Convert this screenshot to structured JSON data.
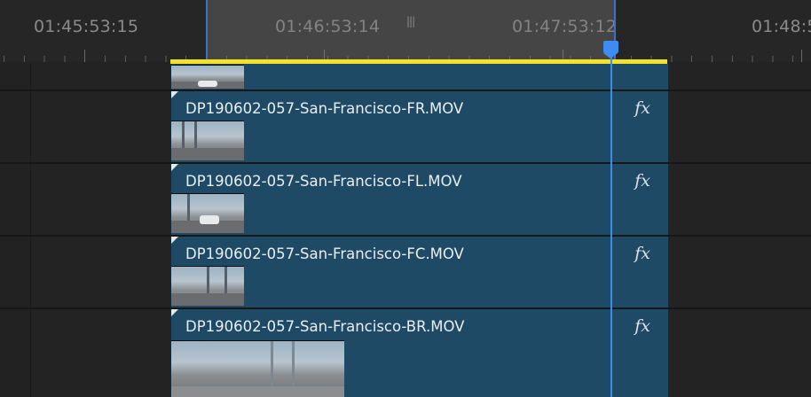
{
  "ruler": {
    "timecodes": [
      "01:45:53:15",
      "01:46:53:14",
      "01:47:53:12",
      "01:48:5"
    ]
  },
  "zoom_bar": {
    "grip_glyph": "|||"
  },
  "clips": [
    {
      "name": "",
      "fx": ""
    },
    {
      "name": "DP190602-057-San-Francisco-FR.MOV",
      "fx": "fx"
    },
    {
      "name": "DP190602-057-San-Francisco-FL.MOV",
      "fx": "fx"
    },
    {
      "name": "DP190602-057-San-Francisco-FC.MOV",
      "fx": "fx"
    },
    {
      "name": "DP190602-057-San-Francisco-BR.MOV",
      "fx": "fx"
    }
  ],
  "colors": {
    "clip_fill": "#1e4a66",
    "playhead": "#3f8cf0",
    "work_area": "#f2e22a",
    "background": "#232323"
  },
  "icons": {
    "fx_badge": "fx-icon",
    "playhead": "playhead-icon",
    "zoom_grip": "grip-icon"
  }
}
